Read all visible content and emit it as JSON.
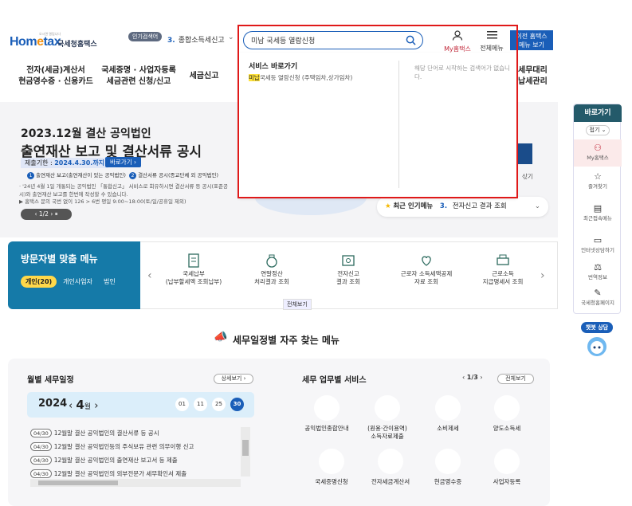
{
  "header": {
    "logo_mark_left": "Hom",
    "logo_mark_o": "e",
    "logo_mark_right": "tax",
    "logo_sub": "오시면 열립니다",
    "logo_name": "국세청홈택스",
    "popular_badge": "인기검색어",
    "popular_num": "3.",
    "popular_text": "종합소득세신고",
    "search_value": "미남 국세등 열람신청",
    "myhome_label": "My홈택스",
    "allmenu_label": "전체메뉴",
    "prev_home_line1": "이전 홈택스",
    "prev_home_line2": "메뉴 보기"
  },
  "gnb": [
    {
      "line1": "전자(세금)계산서",
      "line2": "현금영수증 · 신용카드"
    },
    {
      "line1": "국세증명 · 사업자등록",
      "line2": "세금관련 신청/신고"
    },
    {
      "line1": "세금신고",
      "line2": ""
    },
    {
      "line1": "세무대리",
      "line2": "납세관리"
    }
  ],
  "dropdown": {
    "title": "서비스 바로가기",
    "item_hl": "미납",
    "item_rest": "국세등 열람신청 (주택임차,상가임차)",
    "hint": "해당 단어로 시작하는 검색어가 없습니다."
  },
  "hero": {
    "title1": "2023.12월 결산 공익법인",
    "title2": "출연재산 보고 및 결산서류 공시",
    "deadline_label": "제출기한 :",
    "deadline_value": "2024.4.30.까지",
    "shortcut": "바로가기 ›",
    "bullet1_num": "1",
    "bullet1": "출연재산 보고(출연재산이 있는 공익법인)",
    "bullet2_num": "2",
    "bullet2": "결산서류 공시(종교단체 외 공익법인)",
    "note1": "· '24년 4월 1일 개통되는 공익법인 「통합신고」 서비스로 회유하시면 결산서류 등 공시(표준공시)와 출연재산 보고를 한번에 작성할 수 있습니다.",
    "note2": "▶ 홈택스 문의 국번 없이 126 > 6번 평일 9:00~18:00(토/일/공휴일 제외)",
    "pager": "‹  1/2  ›  ⏸",
    "right_text": "삯기"
  },
  "popular_bar": {
    "label": "최근 인기메뉴",
    "num": "3.",
    "text": "전자신고 결과 조회"
  },
  "sidebar": {
    "title": "바로가기",
    "fold": "접기 ⌄",
    "items": [
      "My홈택스",
      "즐겨찾기",
      "최근접속메뉴",
      "인터넷상담하기",
      "번역정보",
      "국세청홈페이지"
    ],
    "chatbot": "챗봇 상담"
  },
  "visitor": {
    "title": "방문자별 맞춤 메뉴",
    "tabs": [
      "개인(20)",
      "개인사업자",
      "법인"
    ],
    "cards": [
      {
        "line1": "국세납부",
        "line2": "(납부할세액 조회납부)"
      },
      {
        "line1": "연말정산",
        "line2": "처리결과 조회"
      },
      {
        "line1": "전자신고",
        "line2": "결과 조회"
      },
      {
        "line1": "근로자 소득세액공제",
        "line2": "자료 조회"
      },
      {
        "line1": "근로소득",
        "line2": "지급명세서 조회"
      }
    ],
    "view_all": "전체보기"
  },
  "freq_title": "세무일정별 자주 찾는 메뉴",
  "calendar": {
    "title": "월별 세무일정",
    "view_all": "상세보기 ›",
    "year": "2024",
    "month": "4",
    "month_unit": "월",
    "days": [
      "01",
      "11",
      "25",
      "30"
    ],
    "items": [
      {
        "date": "04/30",
        "text": "12월말 결산 공익법인의 결산서류 등 공시"
      },
      {
        "date": "04/30",
        "text": "12월말 결산 공익법인등의 주식보유 관련 의무이행 신고"
      },
      {
        "date": "04/30",
        "text": "12월말 결산 공익법인의 출연재산 보고서 등 제출"
      },
      {
        "date": "04/30",
        "text": "12월말 결산 공익법인의 외부전문가 세무확인서 제출"
      }
    ]
  },
  "services": {
    "title": "세무 업무별 서비스",
    "page": "1/3",
    "view_all": "전체보기",
    "items": [
      {
        "line1": "공익법인종합안내",
        "line2": ""
      },
      {
        "line1": "(원용·간이용역)",
        "line2": "소득자료제출"
      },
      {
        "line1": "소비제세",
        "line2": ""
      },
      {
        "line1": "양도소득세",
        "line2": ""
      },
      {
        "line1": "국세증명신청",
        "line2": ""
      },
      {
        "line1": "전자세금계산서",
        "line2": ""
      },
      {
        "line1": "현금영수증",
        "line2": ""
      },
      {
        "line1": "사업자등록",
        "line2": ""
      }
    ]
  }
}
